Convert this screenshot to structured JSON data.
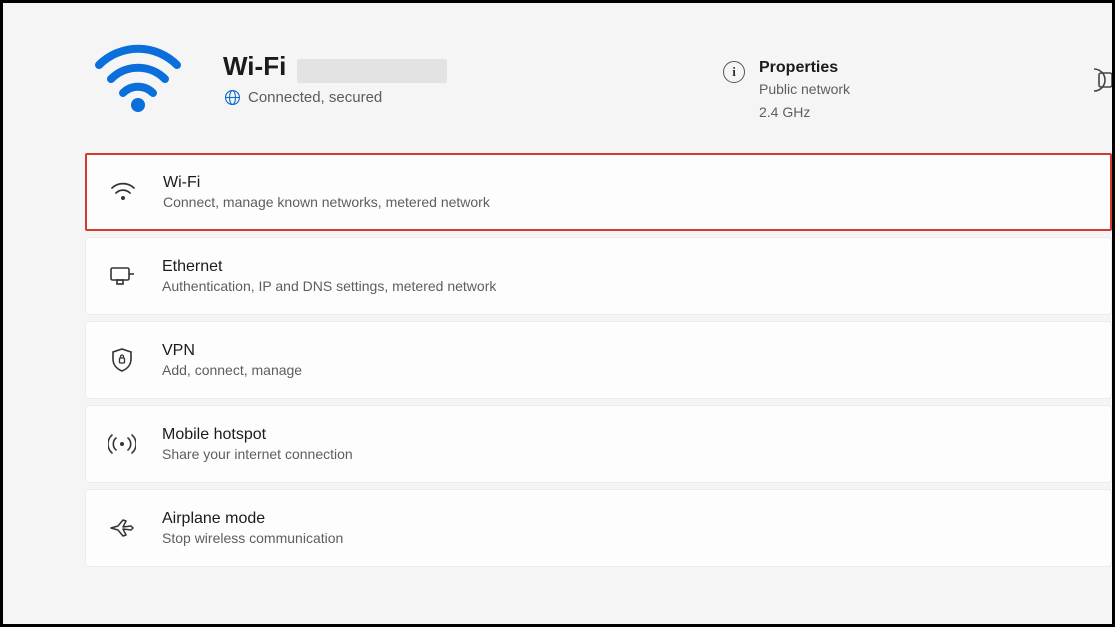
{
  "header": {
    "title": "Wi-Fi",
    "status": "Connected, secured"
  },
  "properties": {
    "title": "Properties",
    "line1": "Public network",
    "line2": "2.4 GHz"
  },
  "items": [
    {
      "title": "Wi-Fi",
      "subtitle": "Connect, manage known networks, metered network"
    },
    {
      "title": "Ethernet",
      "subtitle": "Authentication, IP and DNS settings, metered network"
    },
    {
      "title": "VPN",
      "subtitle": "Add, connect, manage"
    },
    {
      "title": "Mobile hotspot",
      "subtitle": "Share your internet connection"
    },
    {
      "title": "Airplane mode",
      "subtitle": "Stop wireless communication"
    }
  ]
}
